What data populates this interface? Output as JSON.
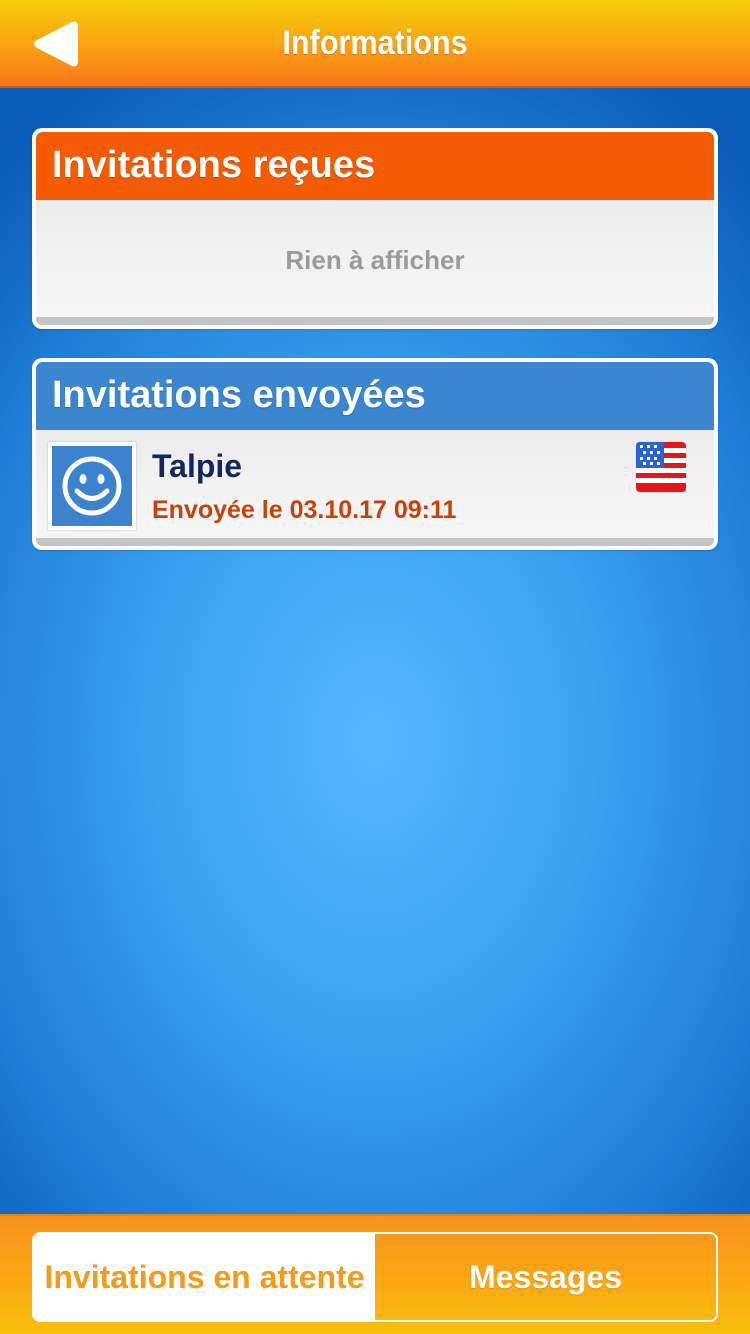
{
  "header": {
    "title": "Informations",
    "back_icon": "back-arrow-icon"
  },
  "received_panel": {
    "title": "Invitations reçues",
    "empty_text": "Rien à afficher",
    "accent_color": "#f45b03"
  },
  "sent_panel": {
    "title": "Invitations envoyées",
    "accent_color": "#3a86cf",
    "items": [
      {
        "name": "Talpie",
        "sent_text": "Envoyée le 03.10.17 09:11",
        "avatar_icon": "smiley-avatar-icon",
        "flag_icon": "usa-flag-icon"
      }
    ]
  },
  "bottom_tabs": {
    "pending_label": "Invitations en attente",
    "messages_label": "Messages",
    "active": "pending"
  }
}
